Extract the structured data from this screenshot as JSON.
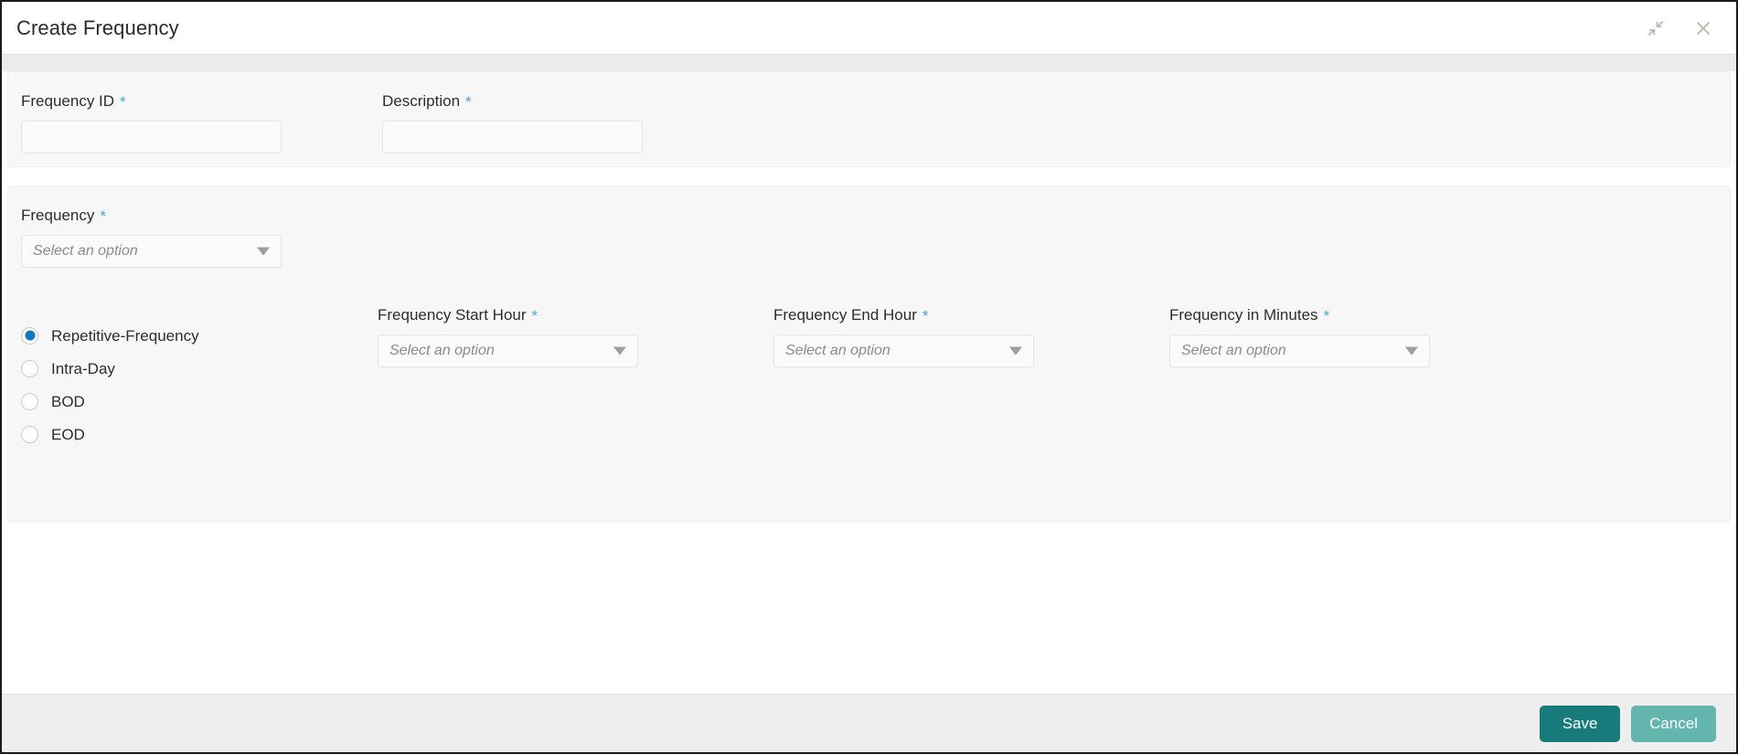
{
  "window": {
    "title": "Create Frequency",
    "restore_icon": "collapse-arrows-icon",
    "close_icon": "close-icon"
  },
  "colors": {
    "required_asterisk": "#3ba7e0",
    "radio_selected": "#1277bf",
    "save_button": "#177b7b",
    "cancel_button": "#62b6ae",
    "panel_background": "#f7f7f7",
    "footer_background": "#eeeeee"
  },
  "form": {
    "required_marker": "*",
    "frequency_id": {
      "label": "Frequency ID",
      "required": true,
      "value": "",
      "placeholder": ""
    },
    "description": {
      "label": "Description",
      "required": true,
      "value": "",
      "placeholder": ""
    },
    "frequency": {
      "label": "Frequency",
      "required": true,
      "value": "Select an option"
    },
    "frequency_type": {
      "selected": "Repetitive-Frequency",
      "options": [
        {
          "label": "Repetitive-Frequency",
          "checked": true
        },
        {
          "label": "Intra-Day",
          "checked": false
        },
        {
          "label": "BOD",
          "checked": false
        },
        {
          "label": "EOD",
          "checked": false
        }
      ]
    },
    "frequency_start_hour": {
      "label": "Frequency Start Hour",
      "required": true,
      "value": "Select an option"
    },
    "frequency_end_hour": {
      "label": "Frequency End Hour",
      "required": true,
      "value": "Select an option"
    },
    "frequency_in_minutes": {
      "label": "Frequency in Minutes",
      "required": true,
      "value": "Select an option"
    }
  },
  "footer": {
    "save_label": "Save",
    "cancel_label": "Cancel"
  }
}
